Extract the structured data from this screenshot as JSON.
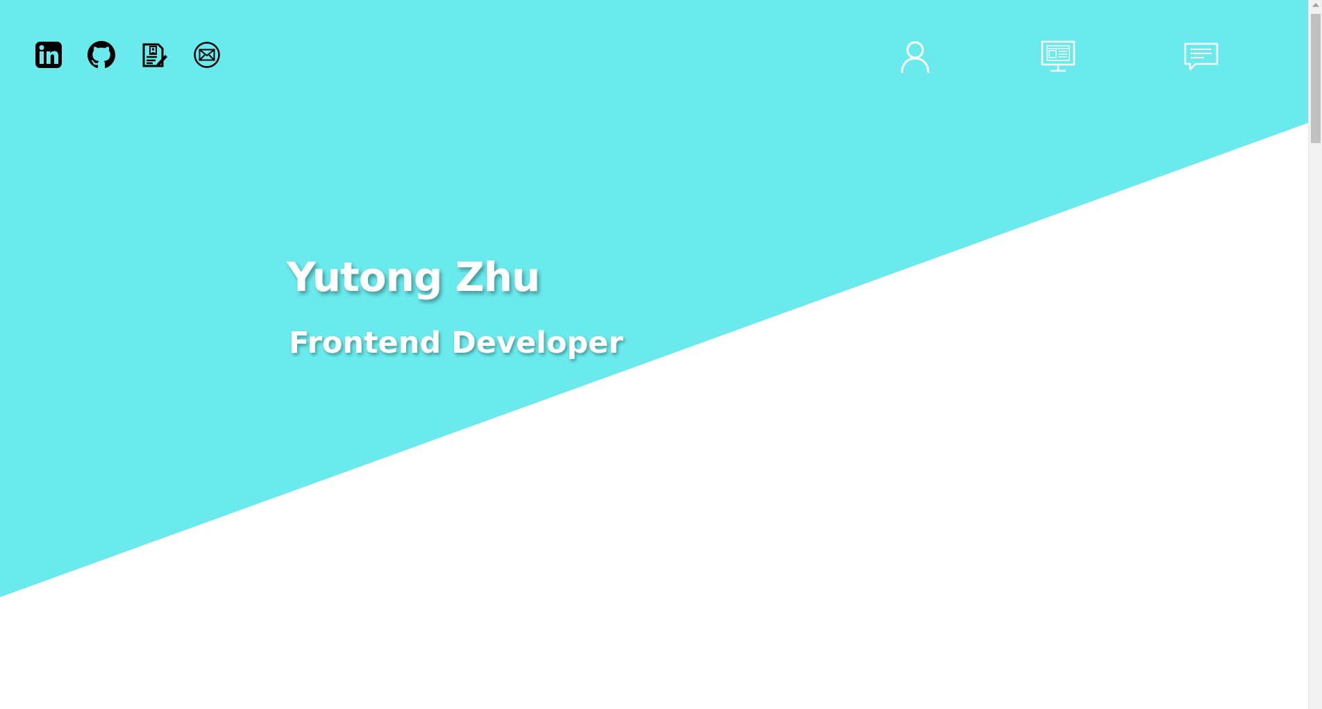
{
  "colors": {
    "hero_accent": "#6aeaec",
    "background": "#ffffff",
    "nav_icon": "#ffffff",
    "social_icon": "#000000"
  },
  "social_links": [
    {
      "name": "linkedin",
      "icon": "linkedin-icon"
    },
    {
      "name": "github",
      "icon": "github-icon"
    },
    {
      "name": "resume",
      "icon": "resume-icon"
    },
    {
      "name": "email",
      "icon": "mail-icon"
    }
  ],
  "nav_items": [
    {
      "name": "about",
      "icon": "user-icon"
    },
    {
      "name": "portfolio",
      "icon": "monitor-icon"
    },
    {
      "name": "contact",
      "icon": "chat-icon"
    }
  ],
  "hero": {
    "name": "Yutong Zhu",
    "role": "Frontend Developer"
  }
}
